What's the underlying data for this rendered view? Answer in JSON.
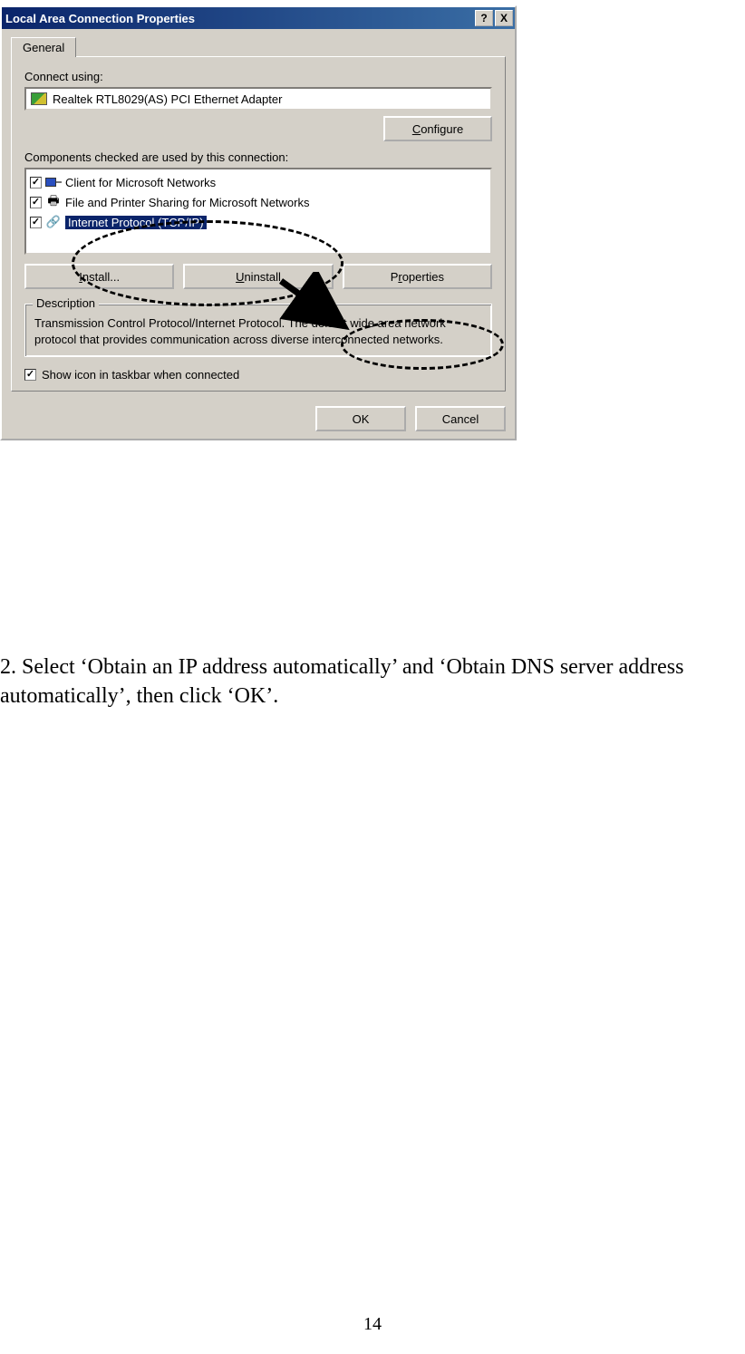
{
  "dialog": {
    "title": "Local Area Connection Properties",
    "help_btn": "?",
    "close_btn": "X",
    "tab_general": "General",
    "connect_using_label": "Connect using:",
    "adapter_name": "Realtek RTL8029(AS) PCI Ethernet Adapter",
    "configure_btn": "Configure",
    "configure_ul": "C",
    "components_label": "Components checked are used by this connection:",
    "components": [
      {
        "label": "Client for Microsoft Networks",
        "selected": false,
        "icon": "monitor"
      },
      {
        "label": "File and Printer Sharing for Microsoft Networks",
        "selected": false,
        "icon": "printer"
      },
      {
        "label": "Internet Protocol (TCP/IP)",
        "selected": true,
        "icon": "net"
      }
    ],
    "install_btn": "Install...",
    "install_ul": "I",
    "uninstall_btn": "Uninstall",
    "uninstall_ul": "U",
    "properties_btn": "Properties",
    "properties_ul": "r",
    "description_legend": "Description",
    "description_text": "Transmission Control Protocol/Internet Protocol. The default wide area network protocol that provides communication across diverse interconnected networks.",
    "show_icon_label": "Show icon in taskbar when connected",
    "show_icon_ul": "w",
    "ok_btn": "OK",
    "cancel_btn": "Cancel"
  },
  "instruction_text": "2. Select ‘Obtain an IP address automatically’ and ‘Obtain DNS server address automatically’, then click ‘OK’.",
  "page_number": "14"
}
